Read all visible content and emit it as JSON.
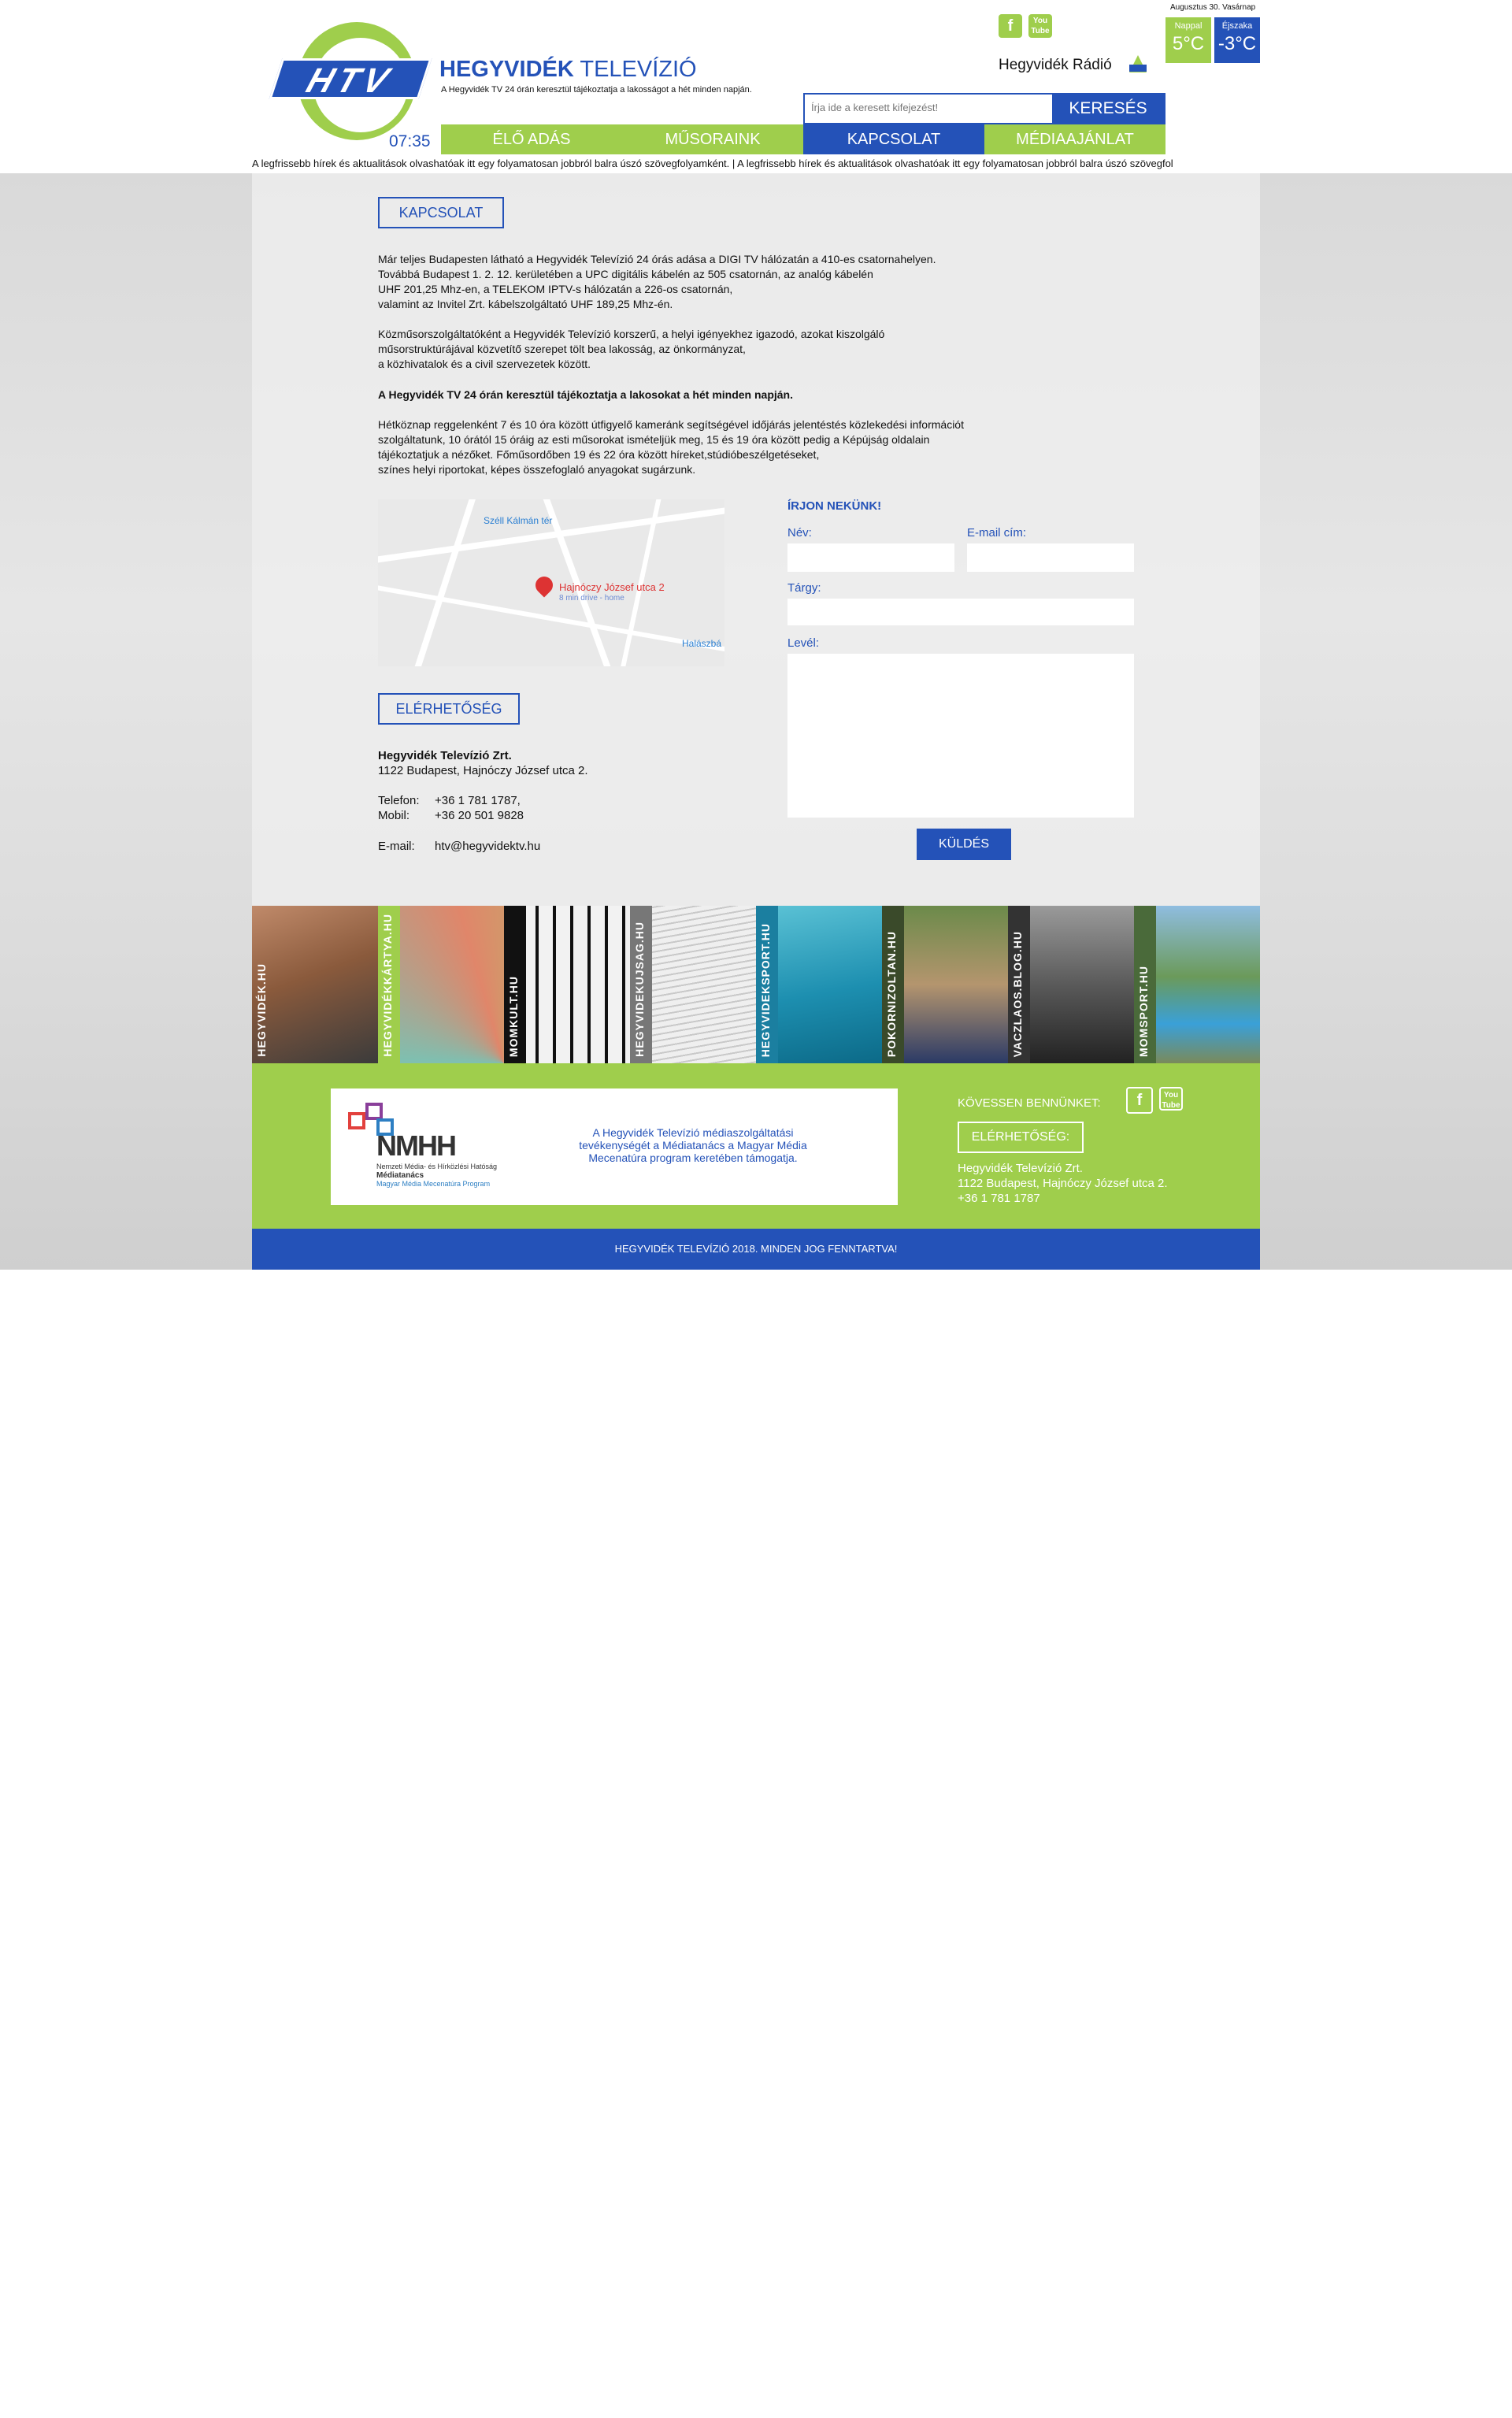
{
  "header": {
    "logo_text": "HTV",
    "brand_bold": "HEGYVIDÉK",
    "brand_light": " TELEVÍZIÓ",
    "tagline": "A Hegyvidék TV 24 órán keresztül tájékoztatja a lakosságot a hét minden napján.",
    "clock": "07:35",
    "radio_label": "Hegyvidék Rádió",
    "date": "Augusztus 30. Vasárnap",
    "weather": {
      "day_label": "Nappal",
      "day_value": "5°C",
      "night_label": "Éjszaka",
      "night_value": "-3°C"
    },
    "search": {
      "placeholder": "Írja ide a keresett kifejezést!",
      "button": "KERESÉS"
    },
    "social": {
      "facebook": "f",
      "youtube": "You Tube"
    }
  },
  "nav": [
    "ÉLŐ ADÁS",
    "MŰSORAINK",
    "KAPCSOLAT",
    "MÉDIAAJÁNLAT"
  ],
  "ticker": "A legfrissebb hírek és aktualitások olvashatóak itt egy folyamatosan jobbról balra úszó szövegfolyamként.    |    A legfrissebb hírek és aktualitások olvashatóak itt egy folyamatosan jobbról balra úszó szövegfol",
  "kapcsolat": {
    "heading": "KAPCSOLAT",
    "p1": [
      "Már teljes Budapesten látható a Hegyvidék Televízió 24 órás adása a DIGI TV hálózatán a 410-es csatornahelyen.",
      "Továbbá Budapest 1. 2. 12. kerületében a UPC digitális kábelén az 505 csatornán, az analóg kábelén",
      "UHF 201,25 Mhz-en, a TELEKOM IPTV-s hálózatán a 226-os csatornán,",
      "valamint az Invitel Zrt. kábelszolgáltató UHF 189,25 Mhz-én."
    ],
    "p2": [
      "Közműsorszolgáltatóként a Hegyvidék Televízió korszerű, a helyi igényekhez igazodó, azokat kiszolgáló",
      "műsorstruktúrájával közvetítő szerepet tölt bea lakosság, az önkormányzat,",
      "a közhivatalok és a civil szervezetek között."
    ],
    "p3": "A Hegyvidék TV 24 órán keresztül tájékoztatja a lakosokat a hét minden napján.",
    "p4": [
      "Hétköznap reggelenként 7 és 10 óra között útfigyelő kameránk segítségével időjárás jelentéstés közlekedési információt",
      "szolgáltatunk, 10 órától 15 óráig az esti műsorokat ismételjük meg, 15 és 19 óra között pedig a Képújság oldalain",
      "tájékoztatjuk a nézőket. Főműsordőben 19 és 22 óra között híreket,stúdióbeszélgetéseket,",
      "színes helyi riportokat, képes összefoglaló anyagokat sugárzunk."
    ]
  },
  "map": {
    "metro": "Széll Kálmán tér",
    "address": "Hajnóczy József utca 2",
    "drive": "8 min drive - home",
    "edge": "Halászbá"
  },
  "elerhetoseg": {
    "heading": "ELÉRHETŐSÉG",
    "company": "Hegyvidék Televízió Zrt.",
    "address": "1122 Budapest, Hajnóczy József utca 2.",
    "phone_label": "Telefon:",
    "phone": "+36  1  781 1787,",
    "mobile_label": "Mobil:",
    "mobile": "+36 20 501 9828",
    "email_label": "E-mail:",
    "email": "htv@hegyvidektv.hu"
  },
  "form": {
    "title": "ÍRJON NEKÜNK!",
    "name_label": "Név:",
    "email_label": "E-mail cím:",
    "subject_label": "Tárgy:",
    "message_label": "Levél:",
    "submit": "KÜLDÉS"
  },
  "tiles": [
    "HEGYVIDÉK.HU",
    "HEGYVIDÉKKÁRTYA.HU",
    "MOMKULT.HU",
    "HEGYVIDEKUJSAG.HU",
    "HEGYVIDEKSPORT.HU",
    "POKORNIZOLTAN.HU",
    "VACZLAOS.BLOG.HU",
    "MOMSPORT.HU"
  ],
  "footer": {
    "nmhh_name": "NMHH",
    "nmhh_sub1": "Nemzeti Média- és Hírközlési Hatóság",
    "nmhh_sub2": "Médiatanács",
    "nmhh_sub3": "Magyar Média Mecenatúra Program",
    "nmhh_text": "A Hegyvidék Televízió médiaszolgáltatási tevékenységét a Médiatanács a Magyar Média Mecenatúra program keretében támogatja.",
    "follow": "KÖVESSEN BENNÜNKET:",
    "elerhetoseg_button": "ELÉRHETŐSÉG:",
    "company": "Hegyvidék Televízió Zrt.",
    "address": "1122 Budapest, Hajnóczy József utca 2.",
    "phone": "+36 1 781 1787",
    "copyright": "HEGYVIDÉK TELEVÍZIÓ 2018. MINDEN JOG FENNTARTVA!"
  },
  "colors": {
    "brand_blue": "#2452b8",
    "brand_green": "#9fce4c"
  }
}
